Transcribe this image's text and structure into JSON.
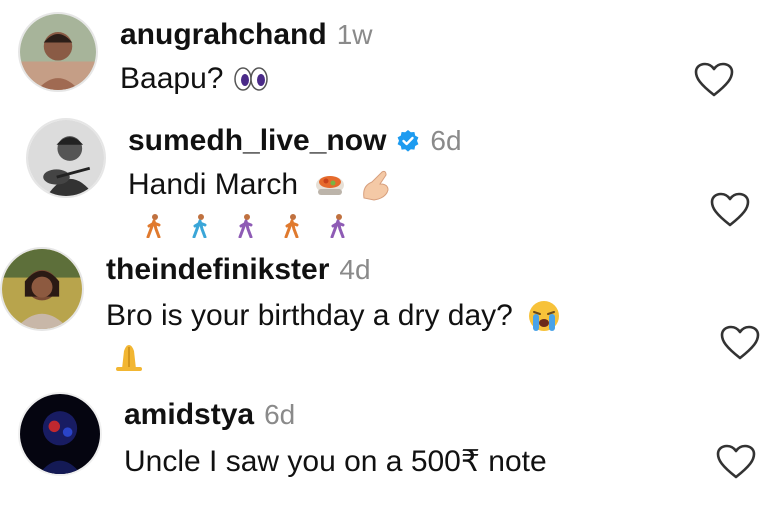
{
  "comments": [
    {
      "username": "anugrahchand",
      "time": "1w",
      "text": "Baapu?",
      "emoji": "eyes-emoji",
      "verified": false,
      "avatar": "avatar-anugrahchand"
    },
    {
      "username": "sumedh_live_now",
      "time": "6d",
      "text": "Handi March",
      "emoji": "pot-of-food-emoji, pinching-hand-emoji, walking-person-emoji x5",
      "verified": true,
      "avatar": "avatar-sumedh_live_now"
    },
    {
      "username": "theindefinikster",
      "time": "4d",
      "text": "Bro is your birthday a dry day?",
      "emoji": "crying-face-emoji, praying-hands-emoji",
      "verified": false,
      "avatar": "avatar-theindefinikster"
    },
    {
      "username": "amidstya",
      "time": "6d",
      "text": "Uncle I saw you on a 500₹ note",
      "emoji": "",
      "verified": false,
      "avatar": "avatar-amidstya"
    }
  ],
  "icons": {
    "like": "heart-outline-icon",
    "verified": "verified-badge-icon"
  },
  "colors": {
    "verified_blue": "#1d9bf0",
    "time_gray": "#8a8a8a"
  }
}
